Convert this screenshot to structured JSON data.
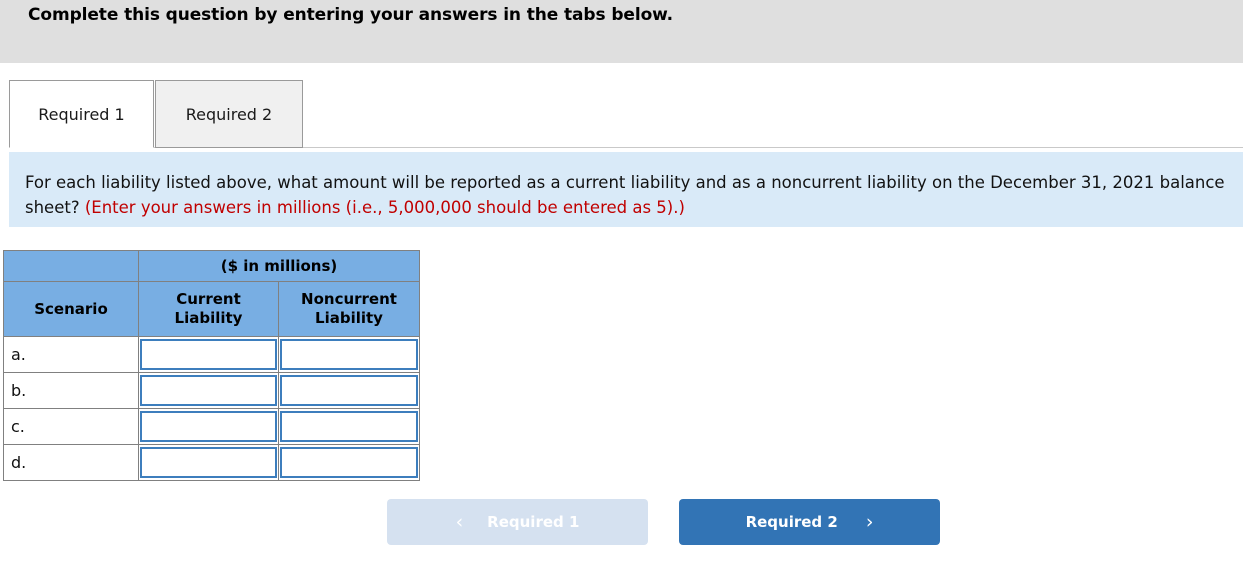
{
  "banner": {
    "instruction": "Complete this question by entering your answers in the tabs below."
  },
  "tabs": [
    {
      "label": "Required 1",
      "state": "active"
    },
    {
      "label": "Required 2",
      "state": "inactive"
    }
  ],
  "question": {
    "body": "For each liability listed above, what amount will be reported as a current liability and as a noncurrent liability on the December 31, 2021 balance sheet? ",
    "note": "(Enter your answers in millions (i.e., 5,000,000 should be entered as 5).)"
  },
  "table": {
    "units_header": "($ in millions)",
    "col_scenario": "Scenario",
    "col_current": "Current Liability",
    "col_current_line1": "Current",
    "col_current_line2": "Liability",
    "col_noncurrent_line1": "Noncurrent",
    "col_noncurrent_line2": "Liability",
    "rows": [
      {
        "label": "a.",
        "current_liability": "",
        "noncurrent_liability": ""
      },
      {
        "label": "b.",
        "current_liability": "",
        "noncurrent_liability": ""
      },
      {
        "label": "c.",
        "current_liability": "",
        "noncurrent_liability": ""
      },
      {
        "label": "d.",
        "current_liability": "",
        "noncurrent_liability": ""
      }
    ]
  },
  "footer": {
    "prev_label": "Required 1",
    "prev_chevron": "‹",
    "prev_enabled": false,
    "next_label": "Required 2",
    "next_chevron": "›",
    "next_enabled": true
  },
  "colors": {
    "banner_bg": "#dfdfdf",
    "question_bg": "#d9eaf8",
    "note_text": "#c00000",
    "table_header_bg": "#78aee3",
    "input_border": "#3d7ebd",
    "next_button_bg": "#3274b5",
    "prev_button_bg": "#d5e1f0"
  }
}
